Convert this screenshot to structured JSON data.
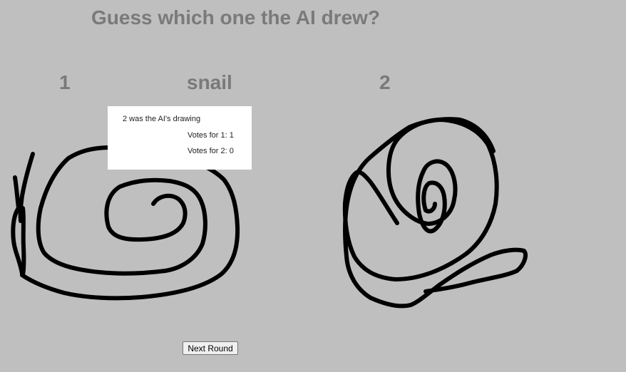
{
  "header": {
    "title": "Guess which one the AI drew?"
  },
  "round": {
    "option_1_label": "1",
    "prompt_word": "snail",
    "option_2_label": "2"
  },
  "result": {
    "answer_text": "2 was the AI's drawing",
    "votes_1_text": "Votes for 1: 1",
    "votes_2_text": "Votes for 2: 0"
  },
  "controls": {
    "next_round_label": "Next Round"
  },
  "colors": {
    "background": "#bfbfbf",
    "heading_text": "#7a7a7a",
    "stroke": "#000000",
    "result_box": "#ffffff"
  }
}
